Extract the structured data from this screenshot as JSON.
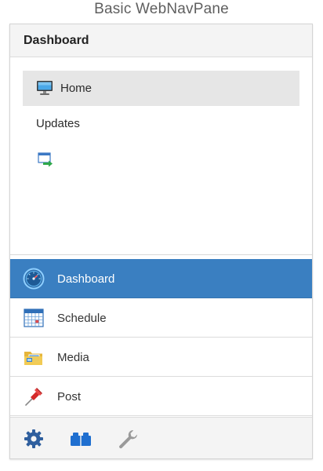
{
  "caption": "Basic WebNavPane",
  "pane": {
    "title": "Dashboard",
    "content_items": [
      {
        "label": "Home",
        "icon": "monitor-icon",
        "selected": true
      },
      {
        "label": "Updates",
        "icon": "",
        "selected": false
      },
      {
        "label": "",
        "icon": "window-arrow-icon",
        "selected": false
      }
    ],
    "nav_items": [
      {
        "label": "Dashboard",
        "icon": "speedometer-icon",
        "active": true
      },
      {
        "label": "Schedule",
        "icon": "calendar-icon",
        "active": false
      },
      {
        "label": "Media",
        "icon": "folder-media-icon",
        "active": false
      },
      {
        "label": "Post",
        "icon": "pushpin-icon",
        "active": false
      }
    ],
    "footer_buttons": [
      {
        "icon": "gear-icon"
      },
      {
        "icon": "blocks-icon"
      },
      {
        "icon": "wrench-icon"
      }
    ]
  },
  "colors": {
    "active_nav": "#3a7fc1",
    "selected_item": "#e6e6e6",
    "header_bg": "#f4f4f4",
    "gear": "#2f5f9e",
    "blocks": "#1f6fd0",
    "wrench": "#9a9a9a"
  }
}
